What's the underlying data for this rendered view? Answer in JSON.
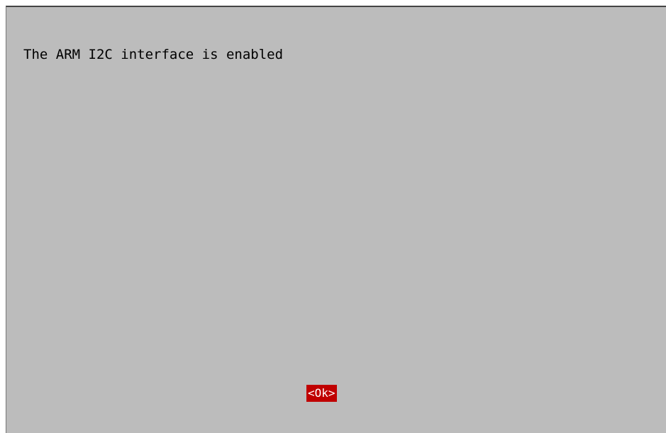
{
  "dialog": {
    "message": "The ARM I2C interface is enabled",
    "ok_label": "<Ok>"
  },
  "colors": {
    "dialog_background": "#bcbcbc",
    "button_background": "#c00000",
    "button_text": "#ffffff",
    "text": "#000000"
  }
}
